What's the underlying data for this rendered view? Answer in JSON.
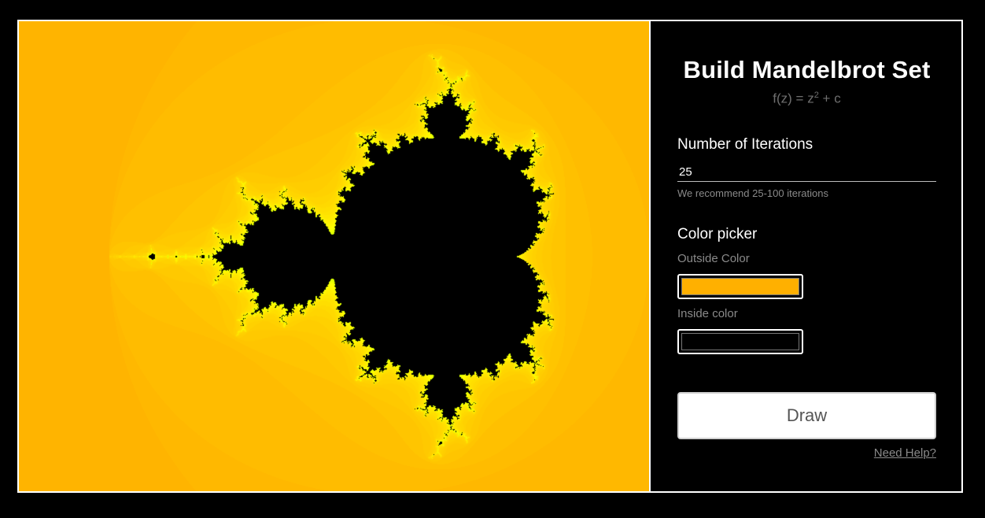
{
  "panel": {
    "title": "Build Mandelbrot Set",
    "formula_base": "f(z) = z",
    "formula_exp": "2",
    "formula_tail": " + c",
    "iterations_label": "Number of Iterations",
    "iterations_value": "25",
    "iterations_hint": "We recommend 25-100 iterations",
    "color_heading": "Color picker",
    "outside_label": "Outside Color",
    "outside_color": "#ffb000",
    "inside_label": "Inside color",
    "inside_color": "#000000",
    "draw_label": "Draw",
    "help_label": "Need Help?"
  },
  "colors": {
    "background": "#000000",
    "gradient_outer": "#ffb000",
    "gradient_mid": "#ffd400",
    "gradient_edge": "#ffff00",
    "gradient_boundary": "#ccff00",
    "set_fill": "#000000"
  }
}
